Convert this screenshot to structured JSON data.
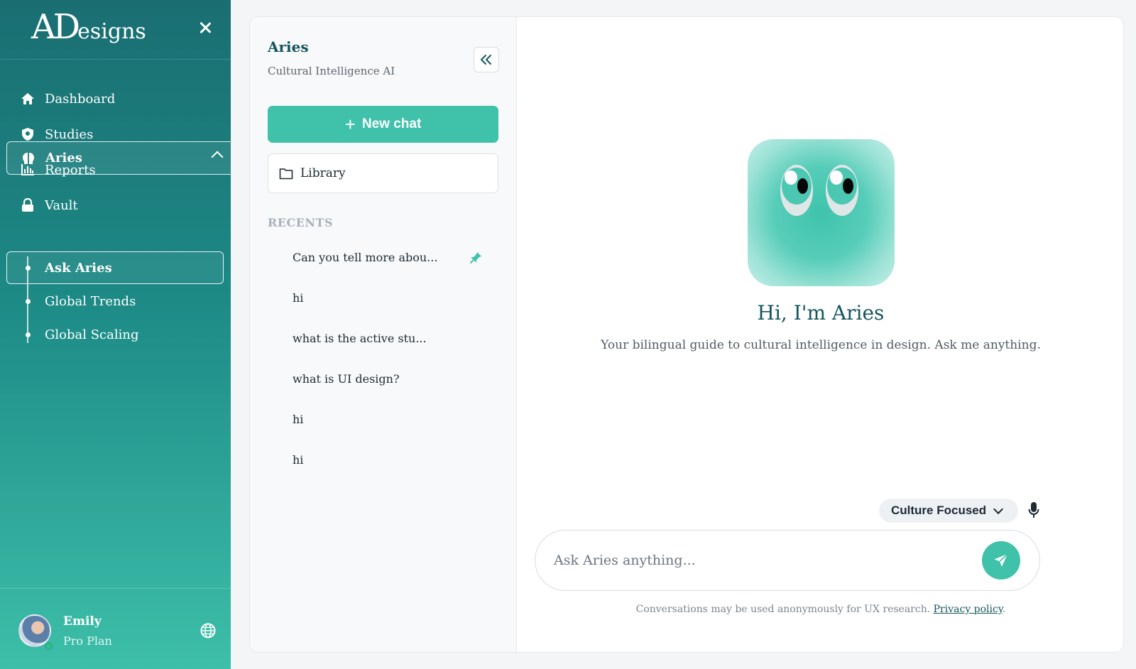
{
  "brand": {
    "logo_big": "AD",
    "logo_small": "esigns"
  },
  "sidebar": {
    "nav": [
      {
        "label": "Dashboard",
        "icon": "home-icon"
      },
      {
        "label": "Studies",
        "icon": "shield-icon"
      },
      {
        "label": "Reports",
        "icon": "bar-chart-icon"
      },
      {
        "label": "Vault",
        "icon": "lock-icon"
      }
    ],
    "aries": {
      "label": "Aries",
      "icon": "brain-icon"
    },
    "sub_items": [
      {
        "label": "Ask Aries",
        "active": true
      },
      {
        "label": "Global Trends"
      },
      {
        "label": "Global Scaling"
      }
    ],
    "user": {
      "name": "Emily",
      "plan": "Pro Plan",
      "status": "online"
    }
  },
  "panel": {
    "title": "Aries",
    "subtitle": "Cultural Intelligence AI",
    "new_chat": "New chat",
    "library": "Library",
    "recents_heading": "RECENTS",
    "recents": [
      {
        "label": "Can you tell more abou...",
        "pinned": true
      },
      {
        "label": "hi"
      },
      {
        "label": "what is the active stu..."
      },
      {
        "label": "what is UI design?"
      },
      {
        "label": "hi"
      },
      {
        "label": "hi"
      }
    ]
  },
  "main": {
    "greeting": "Hi, I'm Aries",
    "subtitle": "Your bilingual guide to cultural intelligence in design. Ask me anything.",
    "mode_label": "Culture Focused",
    "input_placeholder": "Ask Aries anything...",
    "disclaimer_text": "Conversations may be used anonymously for UX research.",
    "privacy_link": "Privacy policy",
    "disclaimer_end": "."
  },
  "colors": {
    "accent": "#3fc1aa",
    "title": "#15555c",
    "sidebar_top": "#1a6e72",
    "sidebar_bottom": "#3dbfa9"
  }
}
